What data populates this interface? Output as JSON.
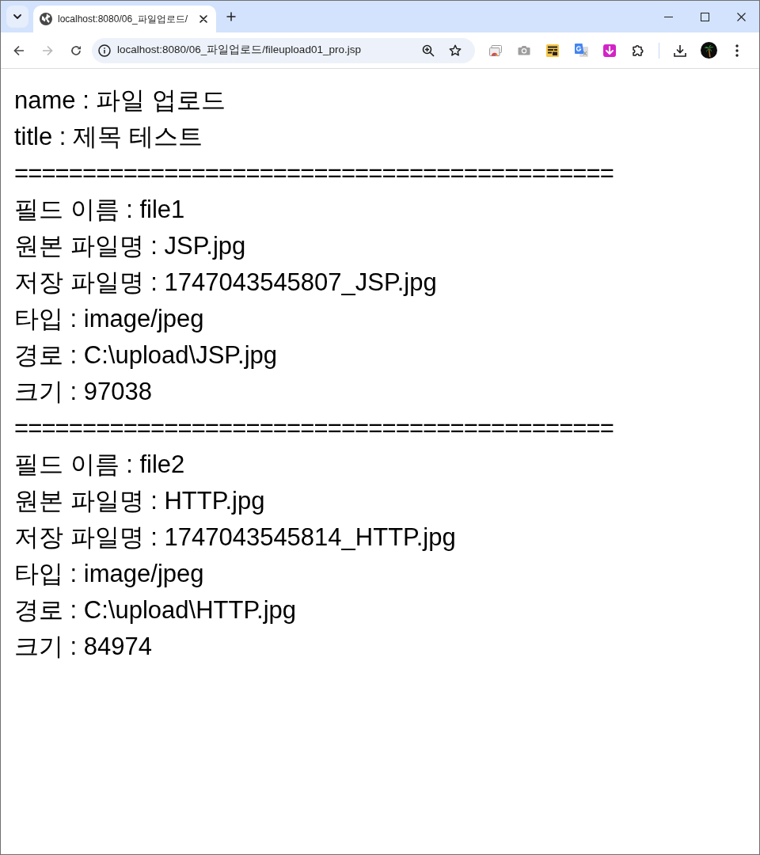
{
  "browser": {
    "tabs": [
      {
        "title": "localhost:8080/06_파일업로드/",
        "selected": true
      }
    ],
    "nav_buttons": [
      {
        "kind": "back",
        "disabled": false
      },
      {
        "kind": "forward",
        "disabled": true
      },
      {
        "kind": "reload",
        "disabled": false
      }
    ],
    "address": "localhost:8080/06_파일업로드/fileupload01_pro.jsp"
  },
  "page": {
    "lines": [
      {
        "kind": "text",
        "text": "name : 파일 업로드"
      },
      {
        "kind": "text",
        "text": "title : 제목 테스트"
      },
      {
        "kind": "separator",
        "text": "============================================"
      },
      {
        "kind": "text",
        "text": "필드 이름 : file1"
      },
      {
        "kind": "text",
        "text": "원본 파일명 : JSP.jpg"
      },
      {
        "kind": "text",
        "text": "저장 파일명 : 1747043545807_JSP.jpg"
      },
      {
        "kind": "text",
        "text": "타입 : image/jpeg"
      },
      {
        "kind": "text",
        "text": "경로 : C:\\upload\\JSP.jpg"
      },
      {
        "kind": "text",
        "text": "크기 : 97038"
      },
      {
        "kind": "separator",
        "text": "============================================"
      },
      {
        "kind": "text",
        "text": "필드 이름 : file2"
      },
      {
        "kind": "text",
        "text": "원본 파일명 : HTTP.jpg"
      },
      {
        "kind": "text",
        "text": "저장 파일명 : 1747043545814_HTTP.jpg"
      },
      {
        "kind": "text",
        "text": "타입 : image/jpeg"
      },
      {
        "kind": "text",
        "text": "경로 : C:\\upload\\HTTP.jpg"
      },
      {
        "kind": "text",
        "text": "크기 : 84974"
      }
    ]
  }
}
